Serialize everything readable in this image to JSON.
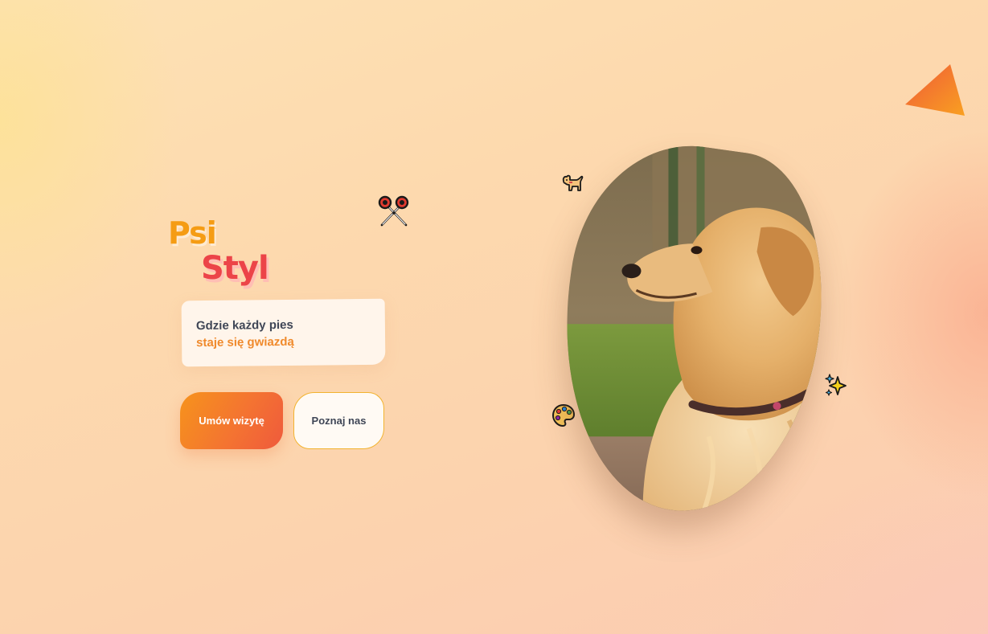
{
  "brand": {
    "line_1": "Psi",
    "line_2": "Styl"
  },
  "tagline": {
    "line_1": "Gdzie każdy pies",
    "line_2": "staje się gwiazdą"
  },
  "actions": {
    "primary_label": "Umów wizytę",
    "secondary_label": "Poznaj nas"
  },
  "decorations": {
    "icons": [
      "scissors-icon",
      "dog-icon",
      "palette-icon",
      "sparkles-icon"
    ],
    "photo": "golden-retriever-photo"
  },
  "colors": {
    "accent_orange": "#f59c14",
    "accent_red": "#ec4448",
    "tagline_highlight": "#f08a2c",
    "text_dark": "#3f4656"
  }
}
